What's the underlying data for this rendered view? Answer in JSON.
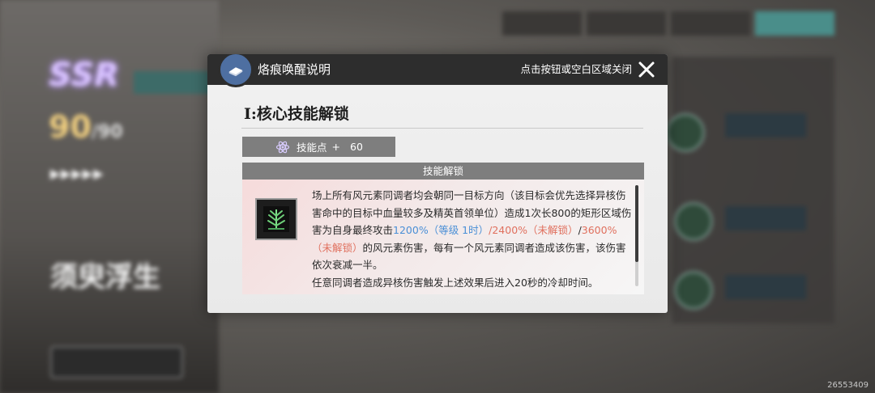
{
  "background": {
    "rarity": "SSR",
    "level_value": "90",
    "level_max": "/90",
    "character_name": "须臾浮生",
    "uid": "26553409"
  },
  "modal": {
    "title": "烙痕唤醒说明",
    "close_hint": "点击按钮或空白区域关闭",
    "section_title": "I:核心技能解锁",
    "skill_points_label": "技能点",
    "skill_points_plus": "+",
    "skill_points_value": "60",
    "unlock_header": "技能解锁",
    "desc": {
      "part1": "场上所有风元素同调者均会朝同一目标方向（该目标会优先选择异核伤害命中的目标中血量较多及精英首领单位）造成1次长800的矩形区域伤害为自身最终攻击",
      "val1": "1200%（等级 1时）",
      "sep1": "/",
      "val2": "2400%（未解锁）",
      "sep2": "/",
      "val3": "3600%（未解锁）",
      "part2": "的风元素伤害，每有一个风元素同调者造成该伤害，该伤害依次衰减一半。",
      "part3": "任意同调者造成异核伤害触发上述效果后进入20秒的冷却时间。"
    }
  },
  "colors": {
    "header_bg": "#2d2d2d",
    "accent_blue": "#4a8fd6",
    "accent_red": "#e0705e",
    "label_bar": "#7e7e7e"
  }
}
